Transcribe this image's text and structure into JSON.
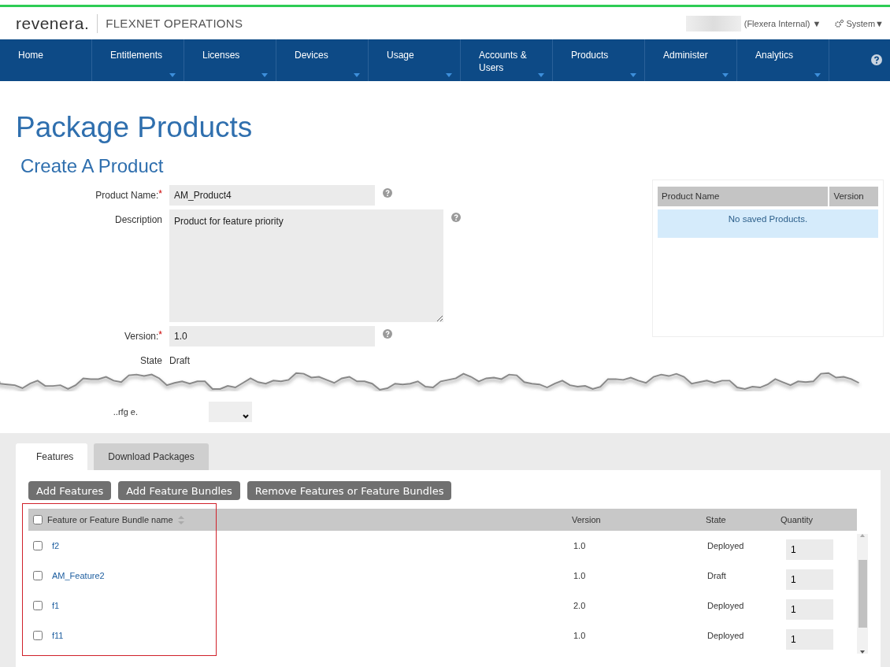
{
  "header": {
    "logo": "revenera.",
    "product": "FLEXNET OPERATIONS",
    "account": "(Flexera Internal) ▼",
    "system": "System▼"
  },
  "nav": [
    {
      "label": "Home",
      "has_menu": false
    },
    {
      "label": "Entitlements",
      "has_menu": true
    },
    {
      "label": "Licenses",
      "has_menu": true
    },
    {
      "label": "Devices",
      "has_menu": true
    },
    {
      "label": "Usage",
      "has_menu": true
    },
    {
      "label": "Accounts & Users",
      "has_menu": true
    },
    {
      "label": "Products",
      "has_menu": true
    },
    {
      "label": "Administer",
      "has_menu": true
    },
    {
      "label": "Analytics",
      "has_menu": true
    }
  ],
  "page_title": "Package Products",
  "section_title": "Create A Product",
  "form": {
    "fields": [
      {
        "kind": "input",
        "label": "Product Name:",
        "required_mark": "*",
        "value": "AM_Product4"
      },
      {
        "kind": "textarea",
        "label": "Description",
        "value": "Product for feature priority"
      },
      {
        "kind": "input",
        "label": "Version:",
        "required_mark": "*",
        "value": "1.0"
      },
      {
        "kind": "text",
        "label": "State",
        "value": "Draft"
      }
    ]
  },
  "saved_products": {
    "columns": [
      "Product Name",
      "Version"
    ],
    "empty_message": "No saved Products."
  },
  "torn_field": {
    "label": "..rfg e."
  },
  "tabs": [
    {
      "label": "Features",
      "selected": true
    },
    {
      "label": "Download Packages",
      "selected": false
    }
  ],
  "buttons": [
    "Add Features",
    "Add Feature Bundles",
    "Remove Features or Feature Bundles"
  ],
  "features_table": {
    "select_all_checked": false,
    "columns": [
      "Feature or Feature Bundle name",
      "Version",
      "State",
      "Quantity"
    ],
    "rows": [
      {
        "name": "f2",
        "version": "1.0",
        "state": "Deployed",
        "quantity": "1",
        "checked": false
      },
      {
        "name": "AM_Feature2",
        "version": "1.0",
        "state": "Draft",
        "quantity": "1",
        "checked": false
      },
      {
        "name": "f1",
        "version": "2.0",
        "state": "Deployed",
        "quantity": "1",
        "checked": false
      },
      {
        "name": "f11",
        "version": "1.0",
        "state": "Deployed",
        "quantity": "1",
        "checked": false
      }
    ]
  }
}
